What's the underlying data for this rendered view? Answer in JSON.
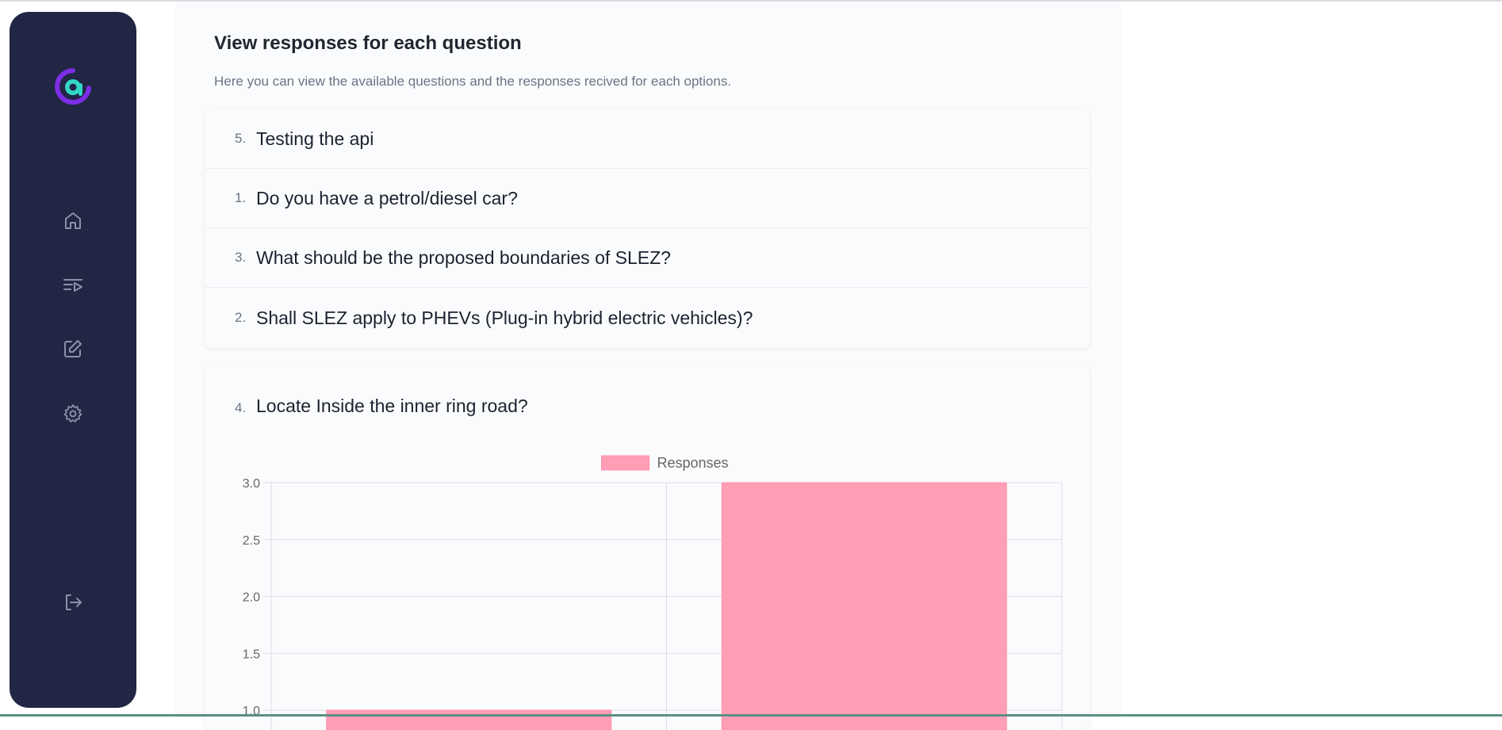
{
  "sidebar": {
    "logo": "at-sign-logo",
    "items": [
      {
        "icon": "home-icon",
        "name": "home"
      },
      {
        "icon": "playlist-icon",
        "name": "surveys"
      },
      {
        "icon": "edit-icon",
        "name": "edit"
      },
      {
        "icon": "gear-icon",
        "name": "settings"
      }
    ],
    "logout_icon": "logout-icon"
  },
  "main": {
    "title": "View responses for each question",
    "subtitle": "Here you can view the available questions and the responses recived for each options.",
    "questions": [
      {
        "num": "5.",
        "text": "Testing the api"
      },
      {
        "num": "1.",
        "text": "Do you have a petrol/diesel car?"
      },
      {
        "num": "3.",
        "text": "What should be the proposed boundaries of SLEZ?"
      },
      {
        "num": "2.",
        "text": "Shall SLEZ apply to PHEVs (Plug-in hybrid electric vehicles)?"
      }
    ],
    "expanded_question": {
      "num": "4.",
      "text": "Locate Inside the inner ring road?"
    }
  },
  "colors": {
    "sidebar_bg": "#212645",
    "bar_fill": "#ff9eb5",
    "bar_border": "#ff8fac",
    "logo_purple": "#7c2ee6",
    "logo_teal": "#33d6c7"
  },
  "chart_data": {
    "type": "bar",
    "categories": [
      "",
      ""
    ],
    "series": [
      {
        "name": "Responses",
        "values": [
          1,
          3
        ]
      }
    ],
    "title": "",
    "xlabel": "",
    "ylabel": "",
    "y_ticks": [
      "3.0",
      "2.5",
      "2.0",
      "1.5",
      "1.0"
    ],
    "ylim_visible": [
      1.0,
      3.0
    ],
    "grid": true,
    "legend": "top-center"
  }
}
